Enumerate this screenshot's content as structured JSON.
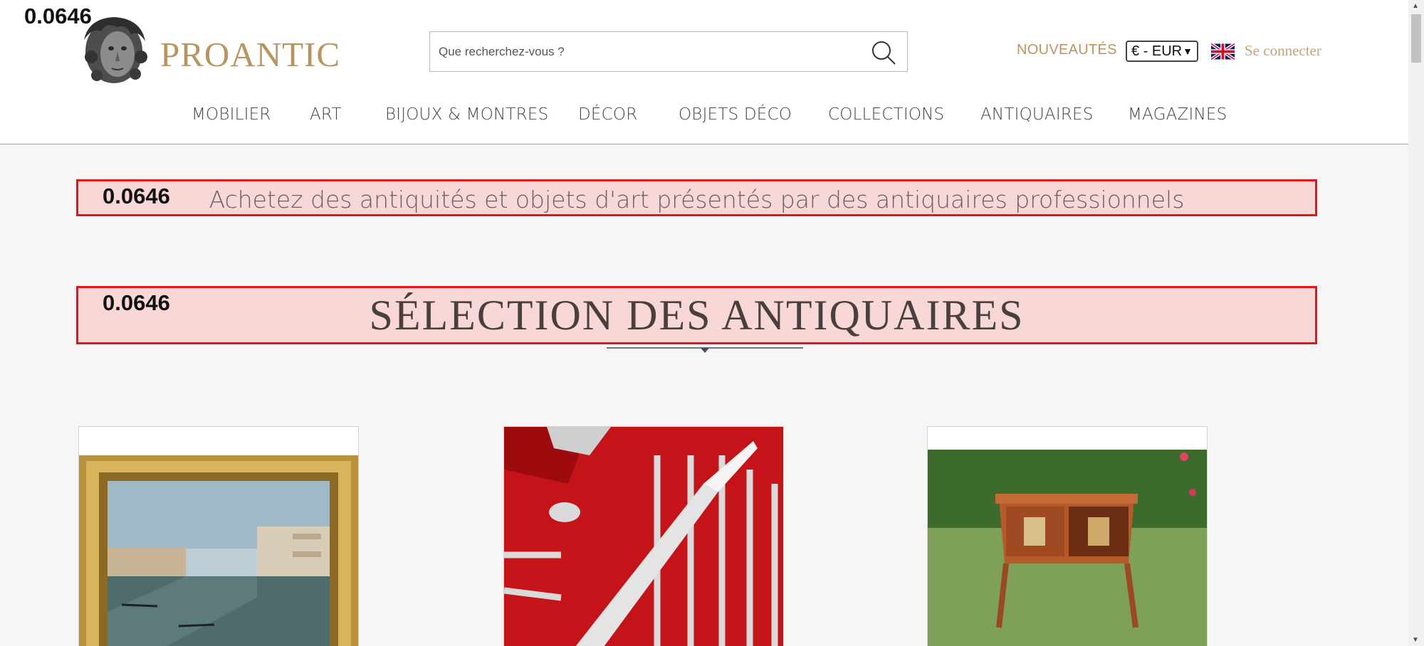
{
  "debug": {
    "label": "0.0646"
  },
  "header": {
    "logo_text": "PROANTIC",
    "search_placeholder": "Que recherchez-vous ?",
    "nouveautes": "NOUVEAUTÉS",
    "currency": "€ - EUR",
    "language_flag": "uk-flag-icon",
    "login": "Se connecter"
  },
  "nav": {
    "items": [
      "MOBILIER",
      "ART",
      "BIJOUX & MONTRES",
      "DÉCOR",
      "OBJETS DÉCO",
      "COLLECTIONS",
      "ANTIQUAIRES",
      "MAGAZINES"
    ]
  },
  "banner": {
    "tagline": "Achetez des antiquités et objets d'art présentés par des antiquaires professionnels",
    "section_title": "SÉLECTION DES ANTIQUAIRES"
  },
  "colors": {
    "accent": "#b89560",
    "highlight_border": "#e2141c",
    "highlight_fill": "#f8d7d7"
  }
}
